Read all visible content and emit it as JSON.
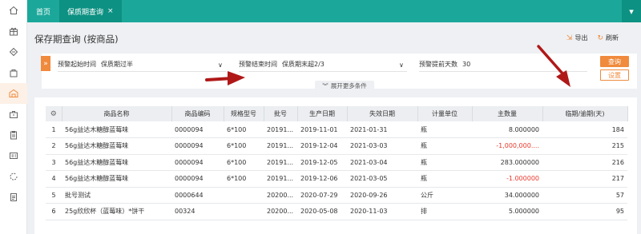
{
  "rail": {
    "icons": [
      "home-icon",
      "gift-icon",
      "diamond-icon",
      "bag-icon",
      "warehouse-icon",
      "briefcase-icon",
      "clipboard-icon",
      "id-card-icon",
      "refresh-cycle-icon",
      "document-icon"
    ],
    "active_index": 4
  },
  "tabs": [
    {
      "label": "首页",
      "active": false
    },
    {
      "label": "保质期查询",
      "close": "×",
      "active": true
    }
  ],
  "page": {
    "title": "保存期查询 (按商品)",
    "export_label": "导出",
    "refresh_label": "刷新"
  },
  "filters": {
    "start_label": "预警起始时间",
    "start_value": "保质期过半",
    "end_label": "预警结束时间",
    "end_value": "保质期末超2/3",
    "days_label": "预警提前天数",
    "days_value": "30",
    "query_label": "查询",
    "reset_label": "设置",
    "more_label": "展开更多条件"
  },
  "table": {
    "columns": [
      "商品名称",
      "商品编码",
      "规格型号",
      "批号",
      "生产日期",
      "失效日期",
      "计量单位",
      "主数量",
      "临期/逾期(天)"
    ],
    "rows": [
      {
        "idx": "1",
        "name": "56g益达木糖醇蓝莓味",
        "code": "0000094",
        "spec": "6*100",
        "batch": "20191...",
        "prod": "2019-11-01",
        "exp": "2021-01-31",
        "unit": "瓶",
        "qty": "8.000000",
        "qty_red": false,
        "days": "184"
      },
      {
        "idx": "2",
        "name": "56g益达木糖醇蓝莓味",
        "code": "0000094",
        "spec": "6*100",
        "batch": "20191...",
        "prod": "2019-12-04",
        "exp": "2021-03-03",
        "unit": "瓶",
        "qty": "-1,000,000....",
        "qty_red": true,
        "days": "215"
      },
      {
        "idx": "3",
        "name": "56g益达木糖醇蓝莓味",
        "code": "0000094",
        "spec": "6*100",
        "batch": "20191...",
        "prod": "2019-12-05",
        "exp": "2021-03-04",
        "unit": "瓶",
        "qty": "283.000000",
        "qty_red": false,
        "days": "216"
      },
      {
        "idx": "4",
        "name": "56g益达木糖醇蓝莓味",
        "code": "0000094",
        "spec": "6*100",
        "batch": "20191...",
        "prod": "2019-12-06",
        "exp": "2021-03-05",
        "unit": "瓶",
        "qty": "-1.000000",
        "qty_red": true,
        "days": "217"
      },
      {
        "idx": "5",
        "name": "批号测试",
        "code": "0000644",
        "spec": "",
        "batch": "20200...",
        "prod": "2020-07-29",
        "exp": "2020-09-26",
        "unit": "公斤",
        "qty": "34.000000",
        "qty_red": false,
        "days": "57"
      },
      {
        "idx": "6",
        "name": "25g欣欣杯（蓝莓味）*饼干",
        "code": "00324",
        "spec": "",
        "batch": "20200...",
        "prod": "2020-05-08",
        "exp": "2020-11-03",
        "unit": "排",
        "qty": "5.000000",
        "qty_red": false,
        "days": "95"
      }
    ]
  },
  "colors": {
    "brand_teal": "#1ba89a",
    "accent_orange": "#f08a3c",
    "negative_red": "#e8372c",
    "arrow_red": "#b01818"
  }
}
